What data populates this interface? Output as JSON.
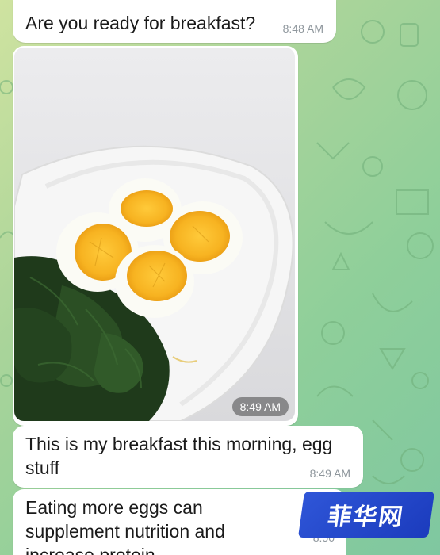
{
  "chat": {
    "messages": [
      {
        "type": "text",
        "text": "Are you ready for breakfast?",
        "time": "8:48 AM"
      },
      {
        "type": "photo",
        "alt": "Boiled eggs and spinach on a white plate",
        "time": "8:49 AM"
      },
      {
        "type": "text",
        "text": "This is my breakfast this morning, egg stuff",
        "time": "8:49 AM"
      },
      {
        "type": "text",
        "text": "Eating more eggs can supplement nutrition and increase protein",
        "time": "8:50"
      }
    ]
  },
  "watermark": {
    "text": "菲华网"
  },
  "colors": {
    "wallpaper_start": "#cfe3a0",
    "wallpaper_end": "#7fc7a0",
    "bubble": "#ffffff",
    "time": "#8e969c",
    "watermark": "#2f56d8"
  },
  "icons": [
    "wallpaper-doodle-icons"
  ]
}
